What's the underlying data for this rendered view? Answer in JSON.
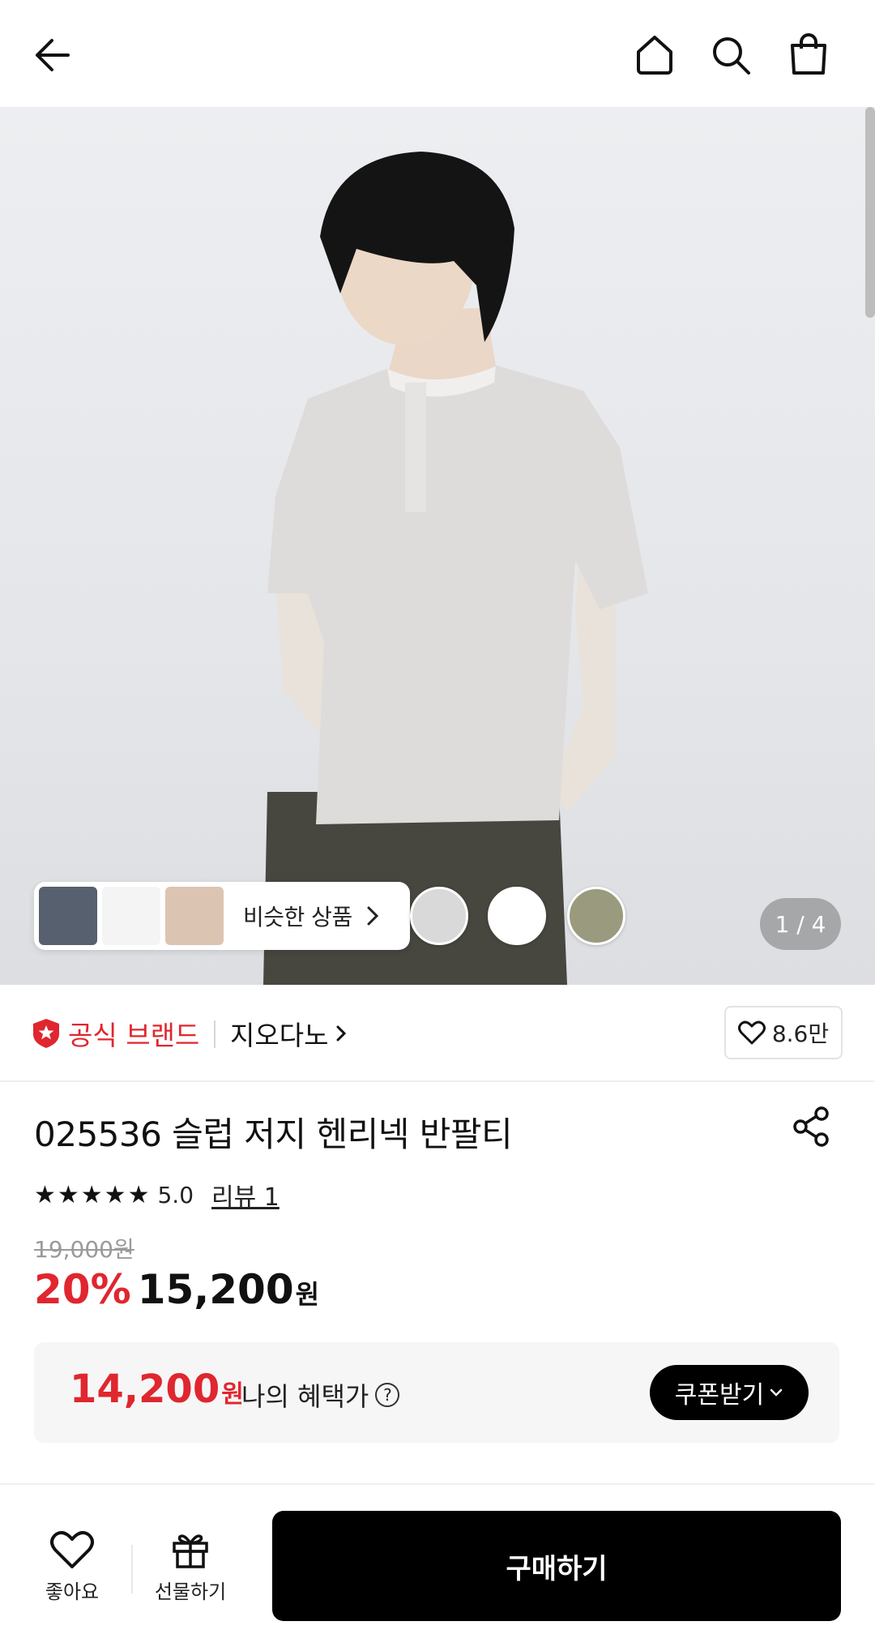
{
  "header": {
    "back_icon": "arrow-left-icon",
    "home_icon": "home-icon",
    "search_icon": "search-icon",
    "cart_icon": "shopping-bag-icon"
  },
  "gallery": {
    "similar_label": "비슷한 상품",
    "counter": "1 / 4",
    "swatches": [
      "#d9d9d9",
      "#ffffff",
      "#9a9a7e"
    ]
  },
  "brand": {
    "official_label": "공식 브랜드",
    "name": "지오다노",
    "likes": "8.6만"
  },
  "product": {
    "title": "025536 슬럽 저지 헨리넥 반팔티",
    "stars": "★★★★★",
    "score": "5.0",
    "review_label": "리뷰 1",
    "original_price": "19,000원",
    "discount": "20%",
    "price": "15,200",
    "won": "원"
  },
  "benefit": {
    "price": "14,200",
    "won": "원",
    "label": "나의 혜택가",
    "help": "?",
    "coupon_button": "쿠폰받기"
  },
  "bottom_bar": {
    "like_label": "좋아요",
    "gift_label": "선물하기",
    "buy_label": "구매하기"
  },
  "colors": {
    "accent_red": "#e0262f",
    "black": "#000000"
  }
}
